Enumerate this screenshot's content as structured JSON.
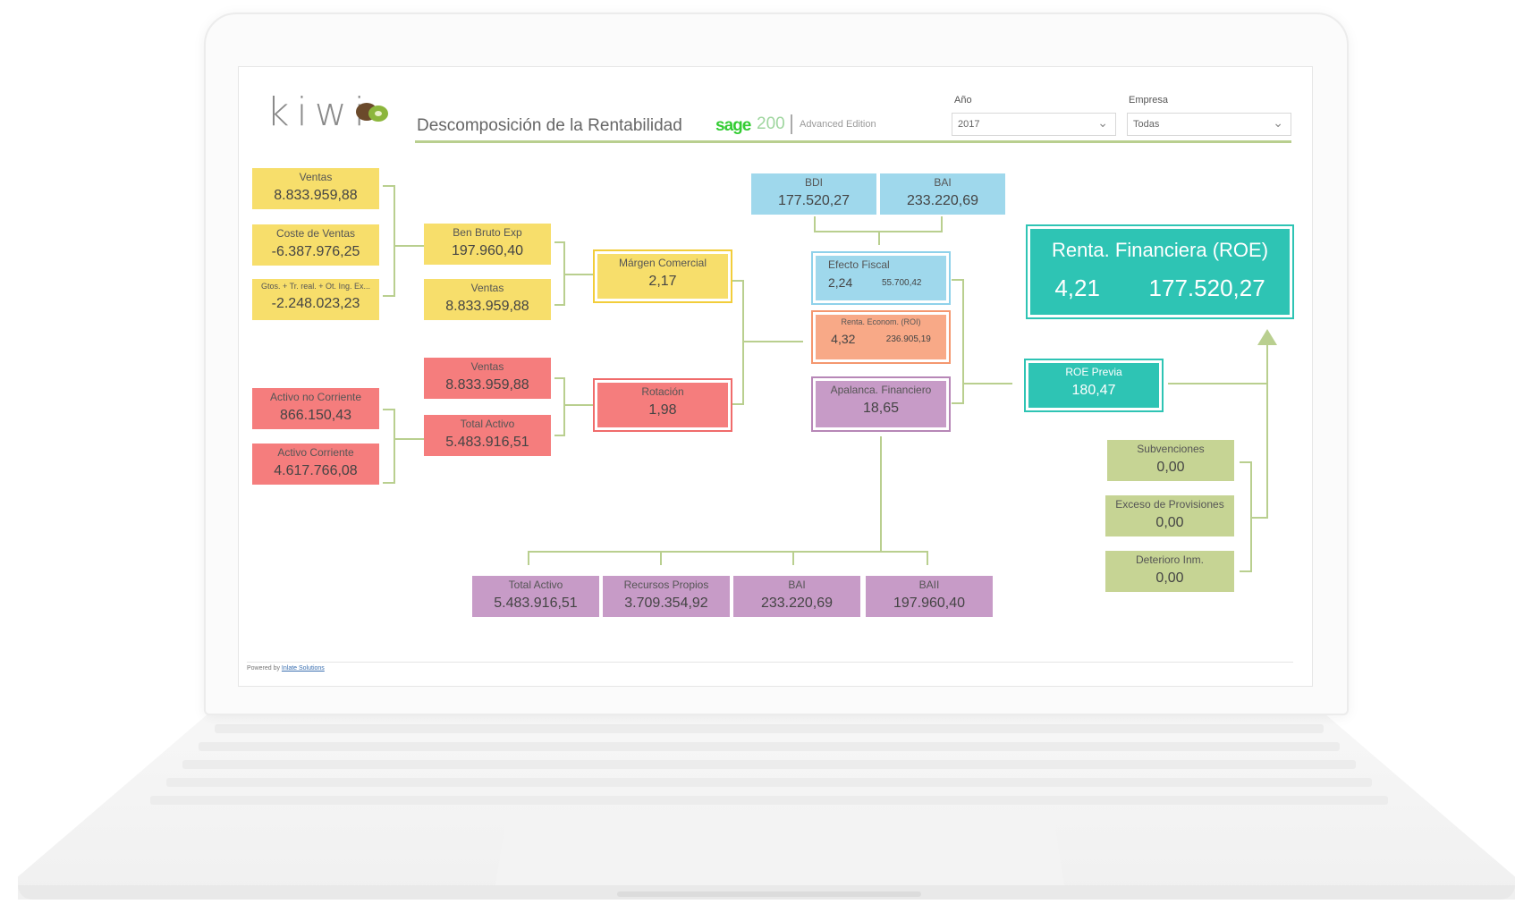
{
  "header": {
    "logo": "kiwi",
    "title": "Descomposición de la Rentabilidad",
    "sage_brand": "sage",
    "sage_number": "200",
    "sage_edition": "Advanced Edition"
  },
  "filters": {
    "year_label": "Año",
    "year_value": "2017",
    "company_label": "Empresa",
    "company_value": "Todas"
  },
  "boxes": {
    "ventas1": {
      "label": "Ventas",
      "value": "8.833.959,88"
    },
    "coste_ventas": {
      "label": "Coste de Ventas",
      "value": "-6.387.976,25"
    },
    "gtos": {
      "label": "Gtos. + Tr. real. + Ot. Ing. Ex...",
      "value": "-2.248.023,23"
    },
    "ben_bruto": {
      "label": "Ben Bruto Exp",
      "value": "197.960,40"
    },
    "ventas2": {
      "label": "Ventas",
      "value": "8.833.959,88"
    },
    "margen": {
      "label": "Márgen Comercial",
      "value": "2,17"
    },
    "activo_no_corr": {
      "label": "Activo no Corriente",
      "value": "866.150,43"
    },
    "activo_corr": {
      "label": "Activo Corriente",
      "value": "4.617.766,08"
    },
    "ventas3": {
      "label": "Ventas",
      "value": "8.833.959,88"
    },
    "total_activo1": {
      "label": "Total Activo",
      "value": "5.483.916,51"
    },
    "rotacion": {
      "label": "Rotación",
      "value": "1,98"
    },
    "bdi": {
      "label": "BDI",
      "value": "177.520,27"
    },
    "bai_top": {
      "label": "BAI",
      "value": "233.220,69"
    },
    "efecto": {
      "label": "Efecto  Fiscal",
      "value": "2,24",
      "value2": "55.700,42"
    },
    "renta_econ": {
      "label": "Renta. Econom. (ROI)",
      "value": "4,32",
      "value2": "236.905,19"
    },
    "apalanca": {
      "label": "Apalanca. Financiero",
      "value": "18,65"
    },
    "roe": {
      "label": "Renta. Financiera (ROE)",
      "value": "4,21",
      "value2": "177.520,27"
    },
    "roe_previa": {
      "label": "ROE Previa",
      "value": "180,47"
    },
    "subvenciones": {
      "label": "Subvenciones",
      "value": "0,00"
    },
    "exceso": {
      "label": "Exceso de Provisiones",
      "value": "0,00"
    },
    "deterioro": {
      "label": "Deterioro Inm.",
      "value": "0,00"
    },
    "total_activo2": {
      "label": "Total Activo",
      "value": "5.483.916,51"
    },
    "recursos": {
      "label": "Recursos Propios",
      "value": "3.709.354,92"
    },
    "bai_bottom": {
      "label": "BAI",
      "value": "233.220,69"
    },
    "baii": {
      "label": "BAII",
      "value": "197.960,40"
    }
  },
  "footer": {
    "text": "Powered by",
    "link": "Inlate Solutions"
  }
}
